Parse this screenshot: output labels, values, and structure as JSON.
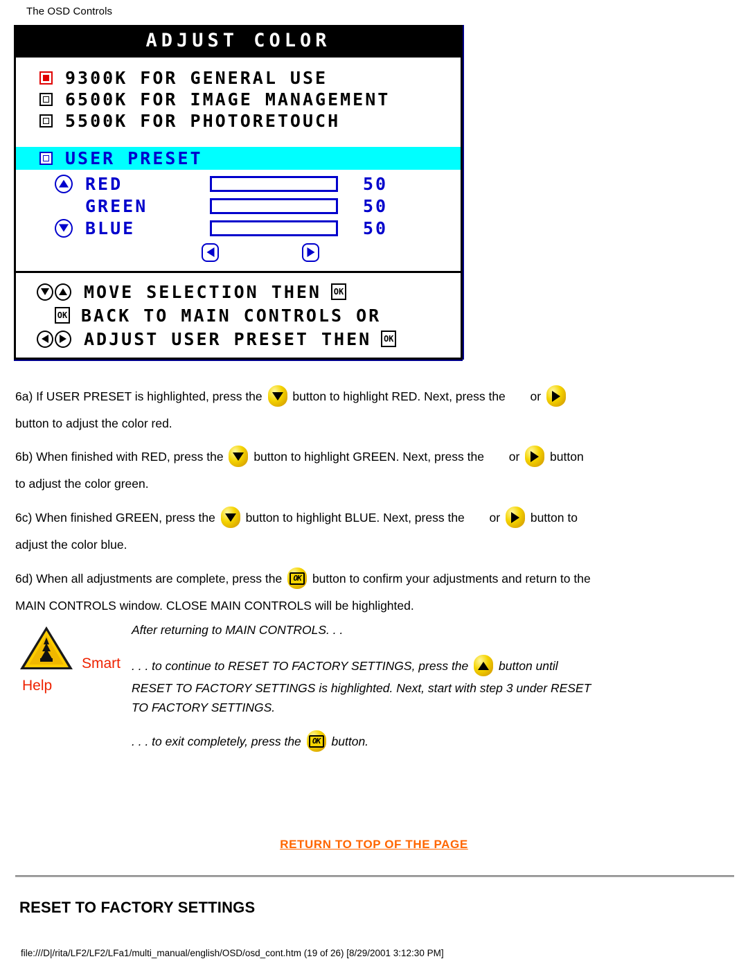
{
  "page": {
    "header": "The OSD Controls",
    "footer": "file:///D|/rita/LF2/LF2/LFa1/multi_manual/english/OSD/osd_cont.htm (19 of 26) [8/29/2001 3:12:30 PM]",
    "return_link": "RETURN TO TOP OF THE PAGE",
    "section_heading": "RESET TO FACTORY SETTINGS"
  },
  "osd": {
    "title": "ADJUST COLOR",
    "presets": [
      {
        "label": "9300K FOR GENERAL USE",
        "selected": true
      },
      {
        "label": "6500K FOR IMAGE MANAGEMENT",
        "selected": false
      },
      {
        "label": "5500K FOR PHOTORETOUCH",
        "selected": false
      }
    ],
    "user_preset": {
      "label": "USER PRESET",
      "highlighted": true
    },
    "sliders": [
      {
        "label": "RED",
        "value": "50",
        "percent": 50,
        "icon": "up-arrow-icon"
      },
      {
        "label": "GREEN",
        "value": "50",
        "percent": 50,
        "icon": "none"
      },
      {
        "label": "BLUE",
        "value": "50",
        "percent": 50,
        "icon": "down-arrow-icon"
      }
    ],
    "nav_buttons": {
      "left": "left-arrow-icon",
      "right": "right-arrow-icon"
    },
    "hints": [
      {
        "icons": [
          "down-arrow-icon",
          "up-arrow-icon"
        ],
        "text": "MOVE SELECTION THEN",
        "trailing_ok": true
      },
      {
        "icons": [
          "ok-icon"
        ],
        "text": "BACK TO MAIN CONTROLS OR",
        "trailing_ok": false
      },
      {
        "icons": [
          "left-arrow-icon",
          "right-arrow-icon"
        ],
        "text": "ADJUST USER PRESET THEN",
        "trailing_ok": true
      }
    ],
    "ok_label": "OK"
  },
  "steps": {
    "s6a_1": "6a) If USER PRESET is highlighted, press the",
    "s6a_2": "button to highlight RED. Next, press the",
    "s6a_3": "or",
    "s6a_4": "button to adjust the color red.",
    "s6b_1": "6b) When finished with RED, press the",
    "s6b_2": "button to highlight GREEN. Next, press the",
    "s6b_3": "or",
    "s6b_4": "button",
    "s6b_5": "to adjust the color green.",
    "s6c_1": "6c) When finished GREEN, press the",
    "s6c_2": "button to highlight BLUE. Next, press the",
    "s6c_3": "or",
    "s6c_4": "button to",
    "s6c_5": "adjust the color blue.",
    "s6d_1": "6d) When all adjustments are complete, press the",
    "s6d_2": "button to confirm your adjustments and return to the",
    "s6d_3": "MAIN CONTROLS window. CLOSE MAIN CONTROLS will be highlighted."
  },
  "smart_help": {
    "smart": "Smart",
    "help": "Help",
    "line_after_return": "After returning to MAIN CONTROLS. . .",
    "line1_a": ". . . to continue to RESET TO FACTORY SETTINGS, press the",
    "line1_b": "button until",
    "line2": "RESET TO FACTORY SETTINGS is highlighted. Next, start with step 3 under RESET",
    "line3": "TO FACTORY SETTINGS.",
    "line4_a": ". . . to exit completely, press the",
    "line4_b": "button."
  },
  "colors": {
    "osd_blue": "#0000cc",
    "highlight_cyan": "#00ffff",
    "selected_red": "#e00000",
    "link_orange": "#ff6600",
    "smart_help_red": "#ee2200",
    "button_yellow": "#f5d400"
  }
}
